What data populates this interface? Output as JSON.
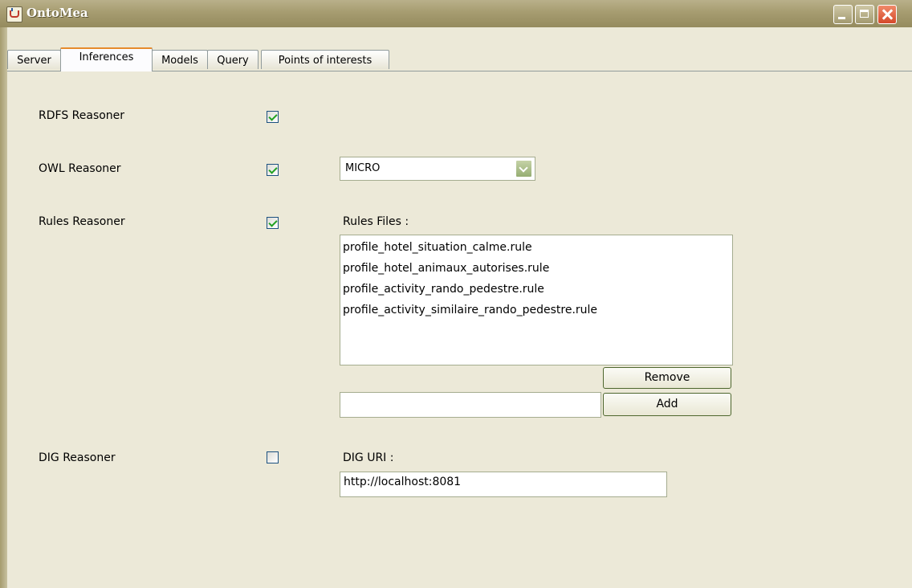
{
  "window": {
    "title": "OntoMea"
  },
  "tabs": [
    {
      "label": "Server"
    },
    {
      "label": "Inferences"
    },
    {
      "label": "Models"
    },
    {
      "label": "Query"
    },
    {
      "label": "Points of interests"
    }
  ],
  "active_tab": "Inferences",
  "inferences": {
    "rdfs": {
      "label": "RDFS Reasoner",
      "checked": true
    },
    "owl": {
      "label": "OWL Reasoner",
      "checked": true,
      "level": "MICRO"
    },
    "rules": {
      "label": "Rules Reasoner",
      "checked": true,
      "files_label": "Rules Files :",
      "files": [
        "profile_hotel_situation_calme.rule",
        "profile_hotel_animaux_autorises.rule",
        "profile_activity_rando_pedestre.rule",
        "profile_activity_similaire_rando_pedestre.rule"
      ],
      "new_file_value": "",
      "remove_label": "Remove",
      "add_label": "Add"
    },
    "dig": {
      "label": "DIG Reasoner",
      "checked": false,
      "uri_label": "DIG URI :",
      "uri_value": "http://localhost:8081"
    }
  },
  "colors": {
    "window_bg": "#ece9d8",
    "title_bar": "#a69c70",
    "active_tab_accent": "#e68b2c",
    "check_mark": "#21a121",
    "close_button": "#d5482a"
  }
}
